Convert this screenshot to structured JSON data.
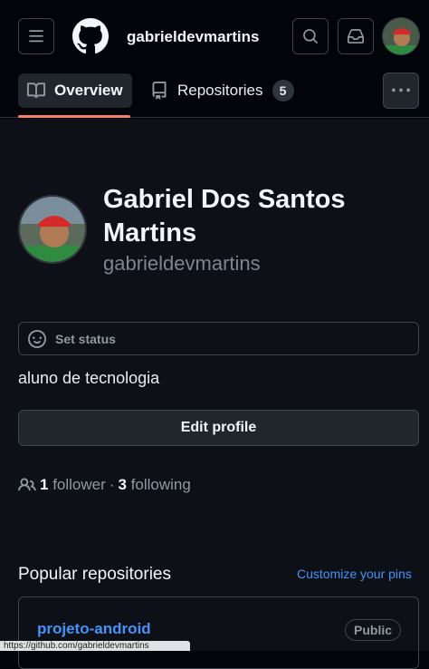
{
  "header": {
    "username": "gabrieldevmartins"
  },
  "tabs": [
    {
      "label": "Overview"
    },
    {
      "label": "Repositories",
      "count": "5"
    }
  ],
  "profile": {
    "fullname": "Gabriel Dos Santos Martins",
    "login": "gabrieldevmartins",
    "status_label": "Set status",
    "bio": "aluno de tecnologia",
    "edit_label": "Edit profile",
    "followers_count": "1",
    "followers_label": "follower",
    "separator": "·",
    "following_count": "3",
    "following_label": "following"
  },
  "popular": {
    "title": "Popular repositories",
    "customize_label": "Customize your pins",
    "repos": [
      {
        "name": "projeto-android",
        "visibility": "Public"
      }
    ]
  },
  "status_bar": {
    "url": "https://github.com/gabrieldevmartins"
  },
  "colors": {
    "accent_link": "#4493f8",
    "tab_underline": "#f78166"
  }
}
